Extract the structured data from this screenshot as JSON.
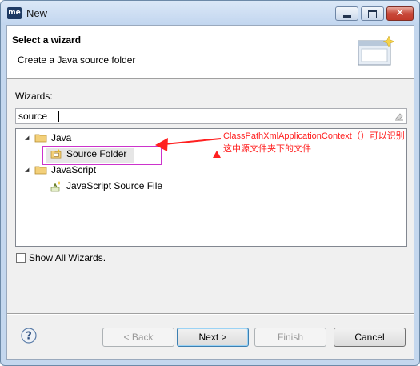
{
  "window": {
    "title": "New",
    "app_icon_text": "me"
  },
  "header": {
    "title": "Select a wizard",
    "description": "Create a Java source folder"
  },
  "wizards_label": "Wizards:",
  "filter": {
    "value": "source"
  },
  "tree": {
    "java": {
      "label": "Java",
      "child": "Source Folder"
    },
    "javascript": {
      "label": "JavaScript",
      "child": "JavaScript Source File"
    }
  },
  "show_all": {
    "label": "Show All Wizards.",
    "checked": false
  },
  "buttons": {
    "back": "< Back",
    "next": "Next >",
    "finish": "Finish",
    "cancel": "Cancel"
  },
  "annotation": {
    "line1": "ClassPathXmlApplicationContext（）可以识别",
    "line2": "这中源文件夹下的文件",
    "color": "#ff2020"
  }
}
